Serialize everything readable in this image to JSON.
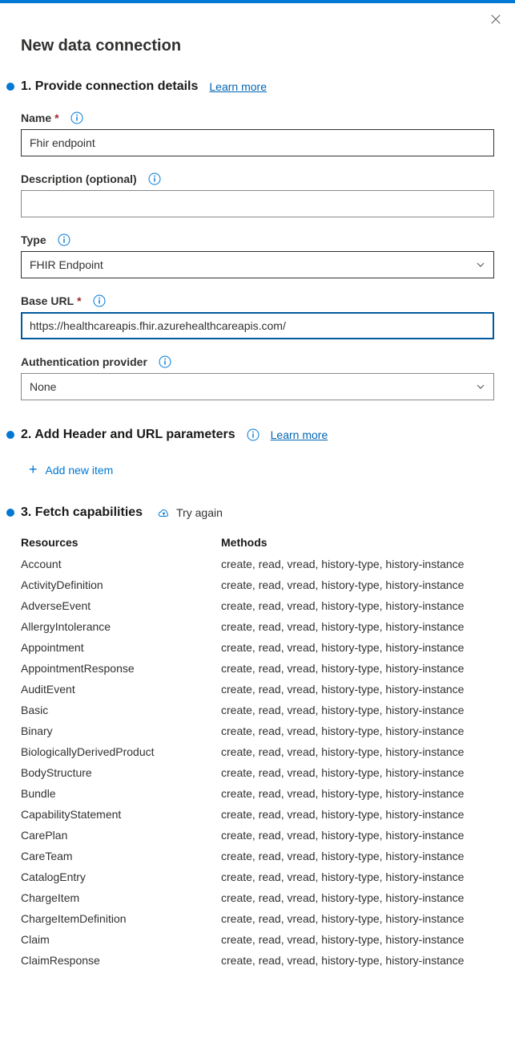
{
  "page_title": "New data connection",
  "close_label": "Close",
  "sections": {
    "s1": {
      "title": "1. Provide connection details",
      "learn_more": "Learn more"
    },
    "s2": {
      "title": "2. Add Header and URL parameters",
      "learn_more": "Learn more",
      "add_item": "Add new item"
    },
    "s3": {
      "title": "3. Fetch capabilities",
      "try_again": "Try again"
    }
  },
  "fields": {
    "name": {
      "label": "Name",
      "value": "Fhir endpoint"
    },
    "description": {
      "label": "Description (optional)",
      "value": ""
    },
    "type": {
      "label": "Type",
      "value": "FHIR Endpoint"
    },
    "base_url": {
      "label": "Base URL",
      "value": "https://healthcareapis.fhir.azurehealthcareapis.com/"
    },
    "auth_provider": {
      "label": "Authentication provider",
      "value": "None"
    }
  },
  "table": {
    "headers": {
      "resources": "Resources",
      "methods": "Methods"
    },
    "method_text": "create, read, vread, history-type, history-instance",
    "rows": [
      "Account",
      "ActivityDefinition",
      "AdverseEvent",
      "AllergyIntolerance",
      "Appointment",
      "AppointmentResponse",
      "AuditEvent",
      "Basic",
      "Binary",
      "BiologicallyDerivedProduct",
      "BodyStructure",
      "Bundle",
      "CapabilityStatement",
      "CarePlan",
      "CareTeam",
      "CatalogEntry",
      "ChargeItem",
      "ChargeItemDefinition",
      "Claim",
      "ClaimResponse"
    ]
  }
}
